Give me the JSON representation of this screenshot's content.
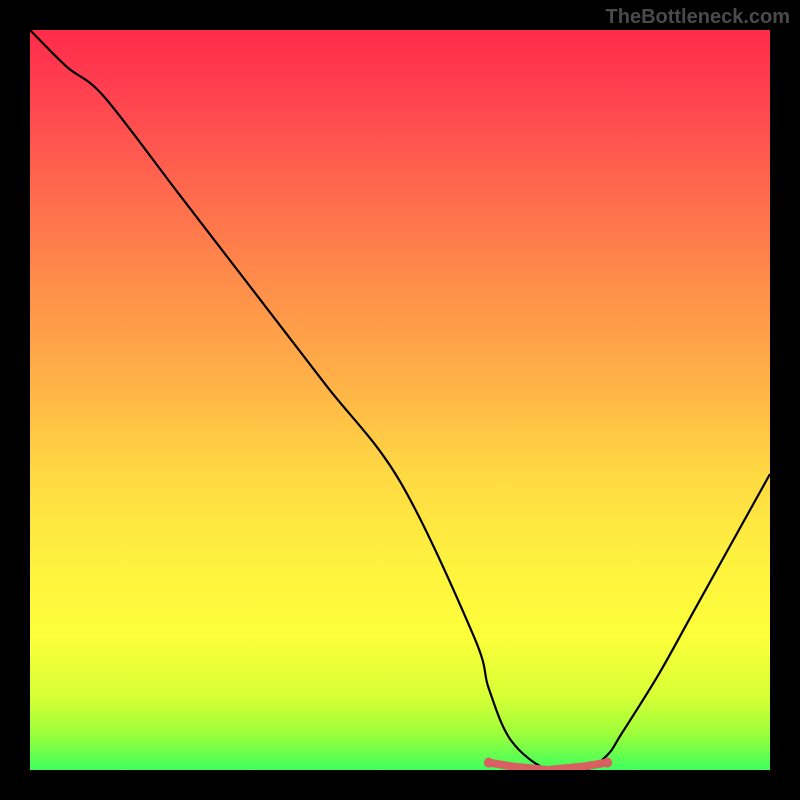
{
  "watermark": "TheBottleneck.com",
  "chart_data": {
    "type": "line",
    "title": "",
    "xlabel": "",
    "ylabel": "",
    "xlim": [
      0,
      100
    ],
    "ylim": [
      0,
      100
    ],
    "series": [
      {
        "name": "bottleneck-curve",
        "x": [
          0,
          5,
          10,
          20,
          30,
          40,
          50,
          60,
          62,
          65,
          70,
          75,
          78,
          80,
          85,
          90,
          100
        ],
        "y": [
          100,
          95,
          91,
          78,
          65,
          52,
          39,
          18,
          11,
          4,
          0,
          0,
          2,
          5,
          13,
          22,
          40
        ]
      },
      {
        "name": "optimal-marker",
        "x": [
          62,
          65,
          70,
          75,
          78
        ],
        "y": [
          1,
          0.5,
          0,
          0.5,
          1
        ]
      }
    ],
    "gradient_colors": {
      "top": "#ff2b4a",
      "mid_upper": "#ff8a4a",
      "mid": "#ffd943",
      "mid_lower": "#fcff3a",
      "bottom": "#3eff5e"
    },
    "marker_color": "#d86060"
  }
}
